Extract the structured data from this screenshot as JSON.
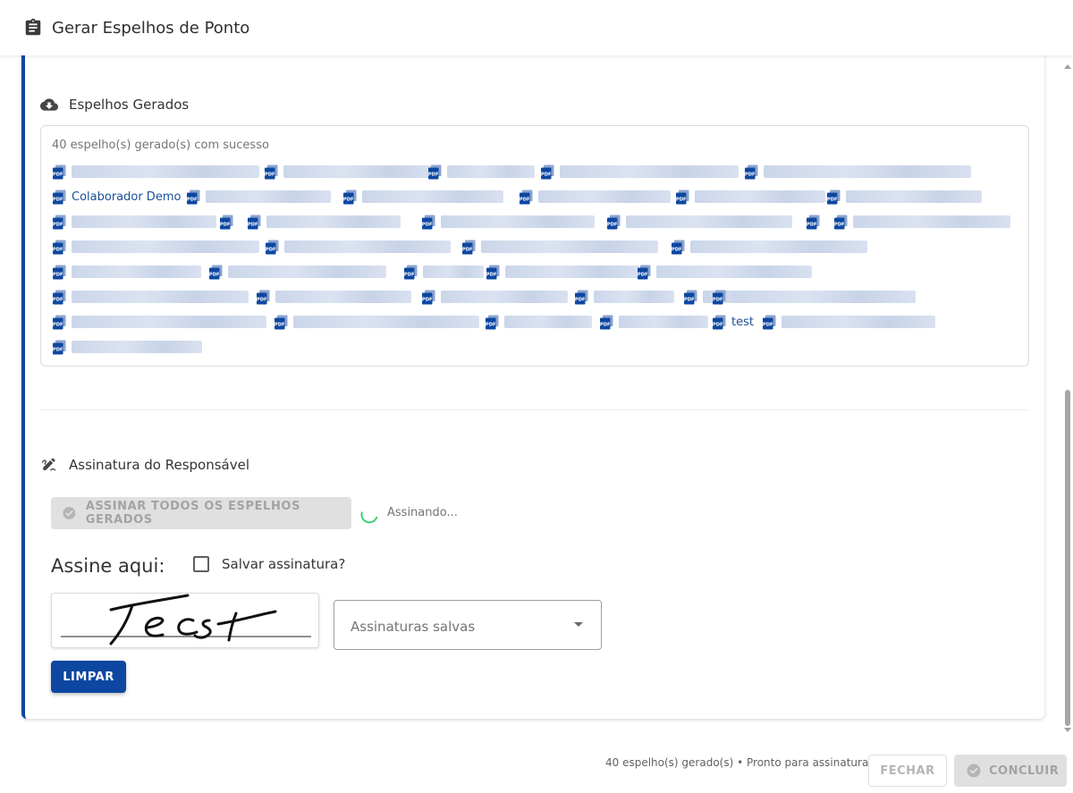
{
  "dialog": {
    "title": "Gerar Espelhos de Ponto",
    "title_icon": "clipboard-icon"
  },
  "generated": {
    "section_title": "Espelhos Gerados",
    "section_icon": "cloud-download-icon",
    "status_text": "40 espelho(s) gerado(s) com sucesso",
    "file_icon": "pdf-file-icon",
    "visible_names": [
      "Colaborador Demo",
      "test"
    ]
  },
  "signature": {
    "section_title": "Assinatura do Responsável",
    "section_icon": "signature-pen-icon",
    "sign_all_button": "ASSINAR TODOS OS ESPELHOS GERADOS",
    "signing_status": "Assinando...",
    "sign_here_label": "Assine aqui:",
    "save_signature_label": "Salvar assinatura?",
    "save_signature_checked": false,
    "saved_signatures_placeholder": "Assinaturas salvas",
    "clear_button": "LIMPAR",
    "drawn_signature": "Test"
  },
  "footer": {
    "status": "40 espelho(s) gerado(s) • Pronto para assinatura",
    "close_button": "FECHAR",
    "finish_button": "CONCLUIR"
  },
  "colors": {
    "primary": "#0d47a1",
    "link": "#1a4f9a",
    "spinner": "#2ecc71",
    "disabled_bg": "#e0e0e0",
    "disabled_text": "#a3a3a3"
  }
}
